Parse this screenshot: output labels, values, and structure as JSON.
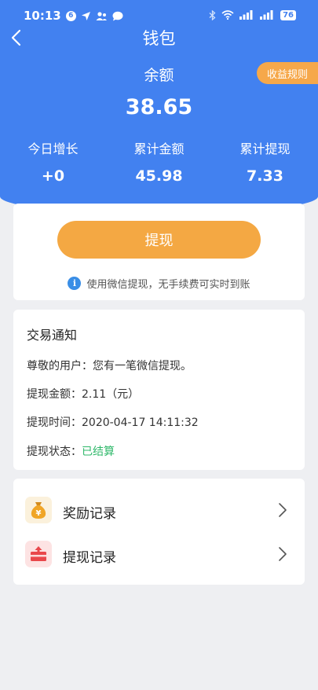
{
  "status_bar": {
    "time": "10:13",
    "badge": "6",
    "battery": "76"
  },
  "nav": {
    "title": "钱包",
    "back_icon": "chevron-left-icon"
  },
  "wallet": {
    "rules_label": "收益规则",
    "balance_label": "余额",
    "balance_value": "38.65",
    "stats": [
      {
        "label": "今日增长",
        "value": "+0"
      },
      {
        "label": "累计金额",
        "value": "45.98"
      },
      {
        "label": "累计提现",
        "value": "7.33"
      }
    ]
  },
  "withdraw": {
    "button_label": "提现",
    "tip": "使用微信提现，无手续费可实时到账",
    "tip_icon": "info-icon",
    "tip_icon_glyph": "i"
  },
  "notice": {
    "title": "交易通知",
    "greeting": "尊敬的用户：您有一笔微信提现。",
    "amount_line": "提现金额：2.11（元）",
    "time_line": "提现时间：2020-04-17 14:11:32",
    "status_label": "提现状态：",
    "status_value": "已结算"
  },
  "records": [
    {
      "label": "奖励记录",
      "icon": "money-bag-icon"
    },
    {
      "label": "提现记录",
      "icon": "gift-box-icon"
    }
  ],
  "colors": {
    "header_blue": "#4281f0",
    "accent_orange": "#f4a843",
    "status_green": "#2fb86a"
  }
}
